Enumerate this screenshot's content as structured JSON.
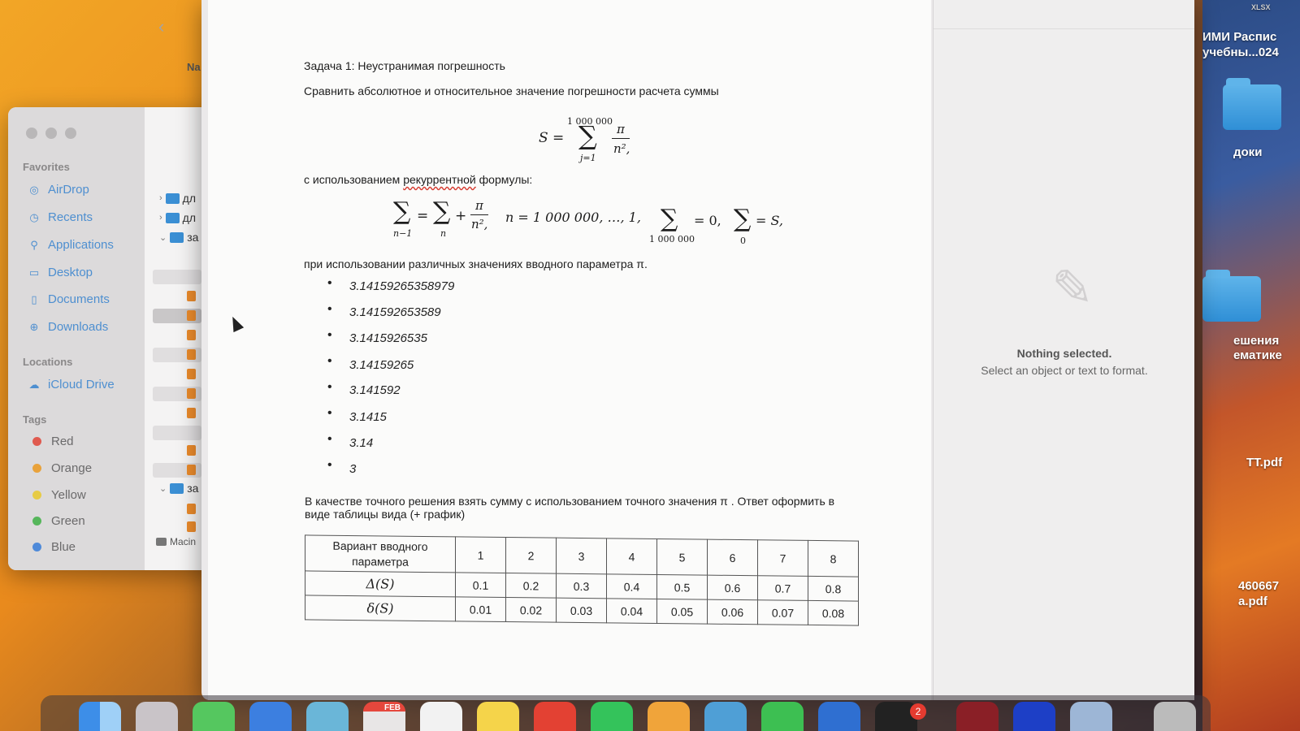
{
  "desktop": {
    "top_right_file": "XLSX",
    "top_right_label_1": "ИМИ Распис",
    "top_right_label_2": "учебны...024",
    "folder_1_label": "доки",
    "folder_2_label_1": "ешения",
    "folder_2_label_2": "ематике",
    "file_pdf_1": "ТТ.pdf",
    "file_pdf_2_line1": "460667",
    "file_pdf_2_line2": "a.pdf"
  },
  "finder": {
    "sidebar": {
      "favorites_heading": "Favorites",
      "favorites": [
        {
          "label": "AirDrop",
          "icon": "airdrop-icon"
        },
        {
          "label": "Recents",
          "icon": "clock-icon"
        },
        {
          "label": "Applications",
          "icon": "applications-icon"
        },
        {
          "label": "Desktop",
          "icon": "desktop-icon"
        },
        {
          "label": "Documents",
          "icon": "document-icon"
        },
        {
          "label": "Downloads",
          "icon": "download-icon"
        }
      ],
      "locations_heading": "Locations",
      "locations": [
        {
          "label": "iCloud Drive",
          "icon": "cloud-icon"
        }
      ],
      "tags_heading": "Tags",
      "tags": [
        {
          "label": "Red",
          "color": "#e05a4f"
        },
        {
          "label": "Orange",
          "color": "#e9a23b"
        },
        {
          "label": "Yellow",
          "color": "#e7cb45"
        },
        {
          "label": "Green",
          "color": "#56b65b"
        },
        {
          "label": "Blue",
          "color": "#4f8ad9"
        }
      ]
    },
    "column_header": "Na",
    "folders": [
      "дл",
      "дл",
      "за",
      "за"
    ],
    "footer": "Macin"
  },
  "document": {
    "task_title": "Задача 1: Неустранимая погрешность",
    "intro": "Сравнить абсолютное и относительное значение погрешности расчета суммы",
    "formula_sum": {
      "lhs": "S =",
      "upper": "1 000 000",
      "lower": "j=1",
      "numerator": "π",
      "denominator": "n²,"
    },
    "recurrent_prefix": "с использованием ",
    "recurrent_word": "рекуррентной",
    "recurrent_suffix": " формулы:",
    "recurrent_formula": {
      "sub_left": "n−1",
      "eq": "=",
      "sub_mid": "n",
      "plus": "+",
      "numerator": "π",
      "denominator": "n²,",
      "range": "n = 1 000 000, …, 1,",
      "sub_init": "1 000 000",
      "init_val": "= 0,",
      "sub_final": "0",
      "final_val": "= S,"
    },
    "params_intro": "при использовании различных значениях вводного параметра π.",
    "pi_values": [
      "3.14159265358979",
      "3.141592653589",
      "3.1415926535",
      "3.14159265",
      "3.141592",
      "3.1415",
      "3.14",
      "3"
    ],
    "conclusion_line1": "В качестве точного решения взять сумму с использованием точного значения π .  Ответ оформить в",
    "conclusion_line2": "виде таблицы вида (+ график)",
    "table": {
      "header_label": "Вариант вводного параметра",
      "columns": [
        "1",
        "2",
        "3",
        "4",
        "5",
        "6",
        "7",
        "8"
      ],
      "rows": [
        {
          "label": "Δ(S)",
          "values": [
            "0.1",
            "0.2",
            "0.3",
            "0.4",
            "0.5",
            "0.6",
            "0.7",
            "0.8"
          ]
        },
        {
          "label": "δ(S)",
          "values": [
            "0.01",
            "0.02",
            "0.03",
            "0.04",
            "0.05",
            "0.06",
            "0.07",
            "0.08"
          ]
        }
      ]
    }
  },
  "inspector": {
    "title": "Nothing selected.",
    "subtitle": "Select an object or text to format."
  },
  "dock": {
    "calendar_month": "FEB",
    "badge_count": "2"
  }
}
